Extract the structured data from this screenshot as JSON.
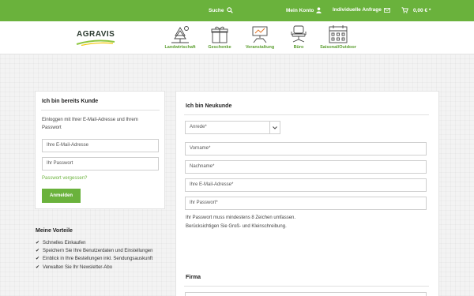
{
  "topbar": {
    "search_label": "Suche",
    "account_label": "Mein Konto",
    "inquiry_label": "Individuelle Anfrage",
    "cart_label": "0,00 € *"
  },
  "header": {
    "logo_text": "AGRAVIS",
    "categories": [
      {
        "label": "Landwirtschaft",
        "icon": "tree-icon"
      },
      {
        "label": "Geschenke",
        "icon": "gift-icon"
      },
      {
        "label": "Veranstaltung",
        "icon": "event-icon"
      },
      {
        "label": "Büro",
        "icon": "office-chair-icon"
      },
      {
        "label": "Saisonal/Outdoor",
        "icon": "calendar-icon"
      }
    ]
  },
  "login": {
    "title": "Ich bin bereits Kunde",
    "intro": [
      "Einloggen mit Ihrer E-Mail-Adresse und Ihrem",
      "Passwort"
    ],
    "email_placeholder": "Ihre E-Mail-Adresse",
    "password_placeholder": "Ihr Passwort",
    "forgot_link": "Passwort vergessen?",
    "submit_label": "Anmelden"
  },
  "benefits": {
    "title": "Meine Vorteile",
    "items": [
      "Schnelles Einkaufen",
      "Speichern Sie Ihre Benutzerdaten und Einstellungen",
      "Einblick in Ihre Bestellungen inkl. Sendungsauskunft",
      "Verwalten Sie Ihr Newsletter-Abo"
    ]
  },
  "register": {
    "title": "Ich bin Neukunde",
    "salutation_value": "Anrede*",
    "firstname_placeholder": "Vorname*",
    "lastname_placeholder": "Nachname*",
    "email_placeholder": "Ihre E-Mail-Adresse*",
    "password_placeholder": "Ihr Passwort*",
    "password_hint": [
      "Ihr Passwort muss mindestens 8 Zeichen umfassen.",
      "Berücksichtigen Sie Groß- und Kleinschreibung."
    ],
    "company_title": "Firma"
  },
  "colors": {
    "brand_green": "#6ab23c",
    "background": "#f3f3f3"
  }
}
